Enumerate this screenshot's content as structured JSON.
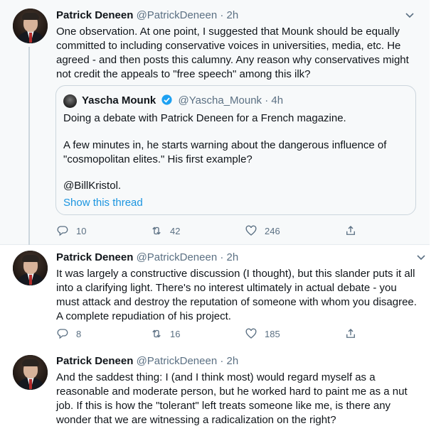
{
  "tweets": [
    {
      "author": "Patrick Deneen",
      "handle": "@PatrickDeneen",
      "time": "· 2h",
      "text": "One observation. At one point, I suggested that Mounk should be equally committed to including conservative voices in universities, media, etc. He agreed - and then posts this calumny. Any reason why conservatives might not credit the appeals to \"free speech\" among this ilk?",
      "quote": {
        "author": "Yascha Mounk",
        "handle": "@Yascha_Mounk",
        "time": "· 4h",
        "line1": "Doing a debate with Patrick Deneen for a French magazine.",
        "line2": "A few minutes in, he starts warning about the dangerous influence of",
        "line3": "\"cosmopolitan elites.\" His first example?",
        "line4": "@BillKristol.",
        "show_thread": "Show this thread"
      },
      "replies": "10",
      "retweets": "42",
      "likes": "246"
    },
    {
      "author": "Patrick Deneen",
      "handle": "@PatrickDeneen",
      "time": "· 2h",
      "text": "It was largely a constructive discussion (I thought), but this slander puts it all into a clarifying light. There's no interest ultimately in actual debate - you must attack and destroy the reputation of someone with whom you disagree. A complete repudiation of his project.",
      "replies": "8",
      "retweets": "16",
      "likes": "185"
    },
    {
      "author": "Patrick Deneen",
      "handle": "@PatrickDeneen",
      "time": "· 2h",
      "text": "And the saddest thing: I (and I think most) would regard myself as a reasonable and moderate person, but he worked hard to paint me as a nut job. If this is how the \"tolerant\" left treats someone like me, is there any wonder that we are witnessing a radicalization on the right?"
    }
  ],
  "colors": {
    "link": "#1b95e0",
    "secondary": "#5b7083",
    "verified": "#1da1f2"
  },
  "icons": [
    "chevron-down-icon",
    "verified-badge-icon",
    "reply-icon",
    "retweet-icon",
    "like-icon",
    "share-icon"
  ]
}
